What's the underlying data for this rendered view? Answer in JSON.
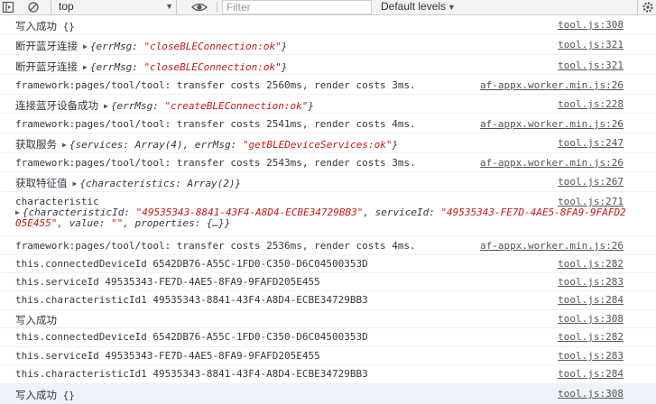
{
  "toolbar": {
    "context": "top",
    "filter_placeholder": "Filter",
    "levels": "Default levels"
  },
  "messages": [
    {
      "text": "写入成功",
      "extra": "{}",
      "source": "tool.js:308"
    },
    {
      "text": "断开蓝牙连接",
      "obj_prefix": "{errMsg: ",
      "obj_str": "\"closeBLEConnection:ok\"",
      "obj_suffix": "}",
      "source": "tool.js:321"
    },
    {
      "text": "断开蓝牙连接",
      "obj_prefix": "{errMsg: ",
      "obj_str": "\"closeBLEConnection:ok\"",
      "obj_suffix": "}",
      "source": "tool.js:321"
    },
    {
      "text": "framework:pages/tool/tool: transfer costs 2560ms, render costs 3ms.",
      "source": "af-appx.worker.min.js:26"
    },
    {
      "text": "连接蓝牙设备成功",
      "obj_prefix": "{errMsg: ",
      "obj_str": "\"createBLEConnection:ok\"",
      "obj_suffix": "}",
      "source": "tool.js:228"
    },
    {
      "text": "framework:pages/tool/tool: transfer costs 2541ms, render costs 4ms.",
      "source": "af-appx.worker.min.js:26"
    },
    {
      "text": "获取服务",
      "obj_prefix": "{services: Array(4), errMsg: ",
      "obj_str": "\"getBLEDeviceServices:ok\"",
      "obj_suffix": "}",
      "source": "tool.js:247"
    },
    {
      "text": "framework:pages/tool/tool: transfer costs 2543ms, render costs 3ms.",
      "source": "af-appx.worker.min.js:26"
    },
    {
      "text": "获取特征值",
      "obj_prefix": "{characteristics: Array(2)}",
      "obj_str": "",
      "obj_suffix": "",
      "source": "tool.js:267"
    },
    {
      "text": "characteristic",
      "source": "tool.js:271",
      "detail": {
        "p1": "{characteristicId: ",
        "s1": "\"49535343-8841-43F4-A8D4-ECBE34729BB3\"",
        "p2": ", serviceId: ",
        "s2": "\"49535343-FE7D-4AE5-8FA9-9FAFD205E455\"",
        "p3": ", value: ",
        "s3": "\"\"",
        "p4": ", properties: {…}}"
      }
    },
    {
      "text": "framework:pages/tool/tool: transfer costs 2536ms, render costs 4ms.",
      "source": "af-appx.worker.min.js:26"
    },
    {
      "text": "this.connectedDeviceId 6542DB76-A55C-1FD0-C350-D6C04500353D",
      "source": "tool.js:282"
    },
    {
      "text": "this.serviceId 49535343-FE7D-4AE5-8FA9-9FAFD205E455",
      "source": "tool.js:283"
    },
    {
      "text": "this.characteristicId1 49535343-8841-43F4-A8D4-ECBE34729BB3",
      "source": "tool.js:284"
    },
    {
      "text": "写入成功",
      "source": "tool.js:308"
    },
    {
      "text": "this.connectedDeviceId 6542DB76-A55C-1FD0-C350-D6C04500353D",
      "source": "tool.js:282"
    },
    {
      "text": "this.serviceId 49535343-FE7D-4AE5-8FA9-9FAFD205E455",
      "source": "tool.js:283"
    },
    {
      "text": "this.characteristicId1 49535343-8841-43F4-A8D4-ECBE34729BB3",
      "source": "tool.js:284"
    },
    {
      "text": "写入成功",
      "extra": "{}",
      "source": "tool.js:308"
    }
  ]
}
